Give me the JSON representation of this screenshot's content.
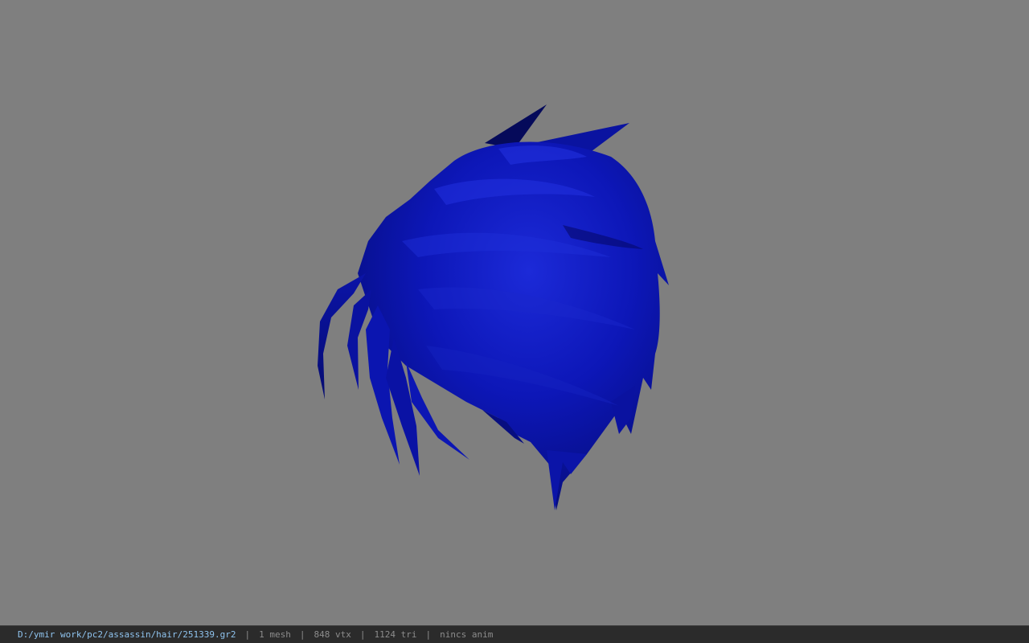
{
  "viewport": {
    "background_color": "#7f7f7f",
    "model": {
      "name": "hair-mesh",
      "color": "#0a12b8"
    }
  },
  "statusbar": {
    "file_path": "D:/ymir work/pc2/assassin/hair/251339.gr2",
    "mesh_count": "1 mesh",
    "vertex_count": "848 vtx",
    "triangle_count": "1124 tri",
    "anim_info": "nincs anim",
    "separator": "|"
  }
}
